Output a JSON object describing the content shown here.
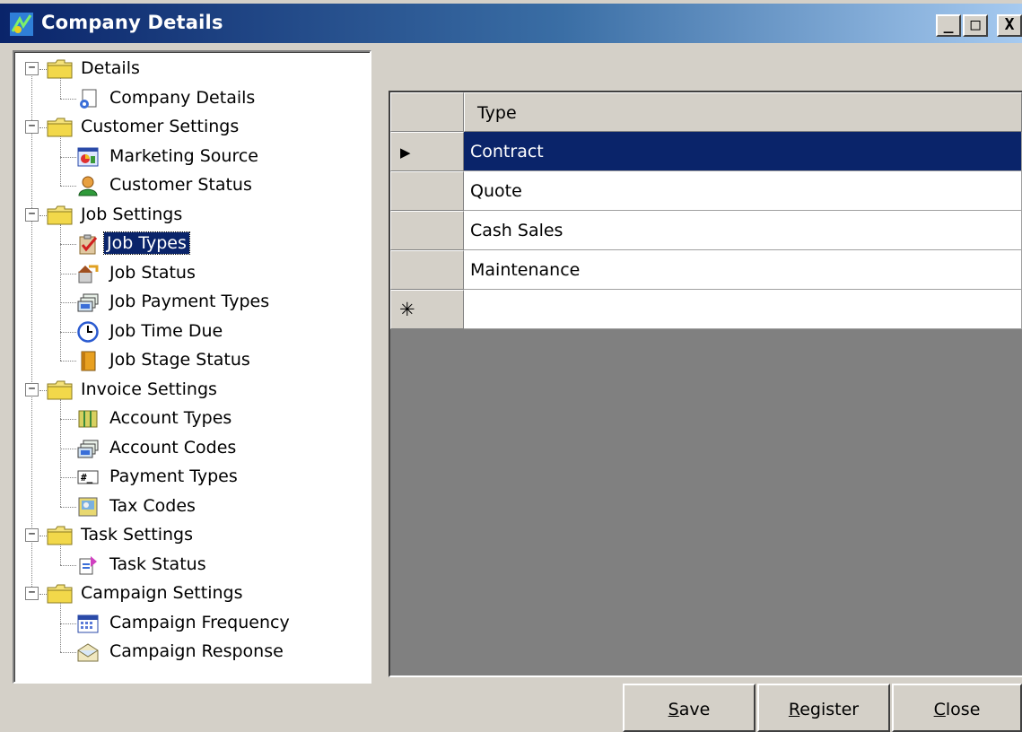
{
  "window": {
    "title": "Company Details",
    "minimize": "_",
    "maximize": "□",
    "close": "X"
  },
  "tree": {
    "groups": [
      {
        "label": "Details",
        "expander": "−",
        "items": [
          {
            "label": "Company Details",
            "icon": "document-gear-icon"
          }
        ]
      },
      {
        "label": "Customer Settings",
        "expander": "−",
        "items": [
          {
            "label": "Marketing Source",
            "icon": "chart-window-icon"
          },
          {
            "label": "Customer Status",
            "icon": "person-icon"
          }
        ]
      },
      {
        "label": "Job Settings",
        "expander": "−",
        "items": [
          {
            "label": "Job Types",
            "icon": "clipboard-check-icon",
            "selected": true
          },
          {
            "label": "Job Status",
            "icon": "house-status-icon"
          },
          {
            "label": "Job Payment Types",
            "icon": "cash-stack-icon"
          },
          {
            "label": "Job Time Due",
            "icon": "clock-icon"
          },
          {
            "label": "Job Stage Status",
            "icon": "book-icon"
          }
        ]
      },
      {
        "label": "Invoice Settings",
        "expander": "−",
        "items": [
          {
            "label": "Account Types",
            "icon": "ledger-icon"
          },
          {
            "label": "Account Codes",
            "icon": "cash-stack-icon"
          },
          {
            "label": "Payment Types",
            "icon": "hash-field-icon"
          },
          {
            "label": "Tax Codes",
            "icon": "tax-card-icon"
          }
        ]
      },
      {
        "label": "Task Settings",
        "expander": "−",
        "items": [
          {
            "label": "Task Status",
            "icon": "task-doc-icon"
          }
        ]
      },
      {
        "label": "Campaign Settings",
        "expander": "−",
        "items": [
          {
            "label": "Campaign Frequency",
            "icon": "calendar-icon"
          },
          {
            "label": "Campaign Response",
            "icon": "envelope-icon"
          }
        ]
      }
    ]
  },
  "grid": {
    "column": "Type",
    "rows": [
      "Contract",
      "Quote",
      "Cash Sales",
      "Maintenance"
    ],
    "selected_row": 0,
    "current_marker": "▶",
    "new_row_marker": "✳"
  },
  "buttons": {
    "save": {
      "mnemonic": "S",
      "rest": "ave"
    },
    "register": {
      "mnemonic": "R",
      "rest": "egister"
    },
    "close": {
      "mnemonic": "C",
      "rest": "lose"
    }
  },
  "colors": {
    "titlebar_start": "#0a246a",
    "titlebar_end": "#a6caf0",
    "selection": "#0a246a",
    "face": "#d4d0c8",
    "grid_bg": "#808080"
  }
}
